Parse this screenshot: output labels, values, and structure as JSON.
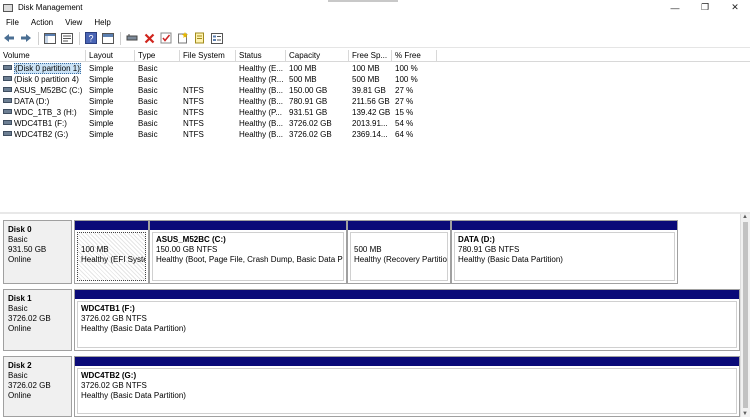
{
  "window": {
    "title": "Disk Management",
    "controls": {
      "minimize": "—",
      "maximize": "❐",
      "close": "✕"
    }
  },
  "menu": [
    "File",
    "Action",
    "View",
    "Help"
  ],
  "toolbar": {
    "buttons": [
      "back-icon",
      "forward-icon",
      "console-tree-icon",
      "properties-icon",
      "help-icon",
      "view-icon",
      "connect-drive-icon",
      "delete-icon",
      "check-icon",
      "new-icon",
      "rescan-icon",
      "settings-icon"
    ]
  },
  "volumes": {
    "columns": [
      "Volume",
      "Layout",
      "Type",
      "File System",
      "Status",
      "Capacity",
      "Free Sp...",
      "% Free"
    ],
    "rows": [
      [
        "(Disk 0 partition 1)",
        "Simple",
        "Basic",
        "",
        "Healthy (E...",
        "100 MB",
        "100 MB",
        "100 %"
      ],
      [
        "(Disk 0 partition 4)",
        "Simple",
        "Basic",
        "",
        "Healthy (R...",
        "500 MB",
        "500 MB",
        "100 %"
      ],
      [
        "ASUS_M52BC (C:)",
        "Simple",
        "Basic",
        "NTFS",
        "Healthy (B...",
        "150.00 GB",
        "39.81 GB",
        "27 %"
      ],
      [
        "DATA (D:)",
        "Simple",
        "Basic",
        "NTFS",
        "Healthy (B...",
        "780.91 GB",
        "211.56 GB",
        "27 %"
      ],
      [
        "WDC_1TB_3 (H:)",
        "Simple",
        "Basic",
        "NTFS",
        "Healthy (P...",
        "931.51 GB",
        "139.42 GB",
        "15 %"
      ],
      [
        "WDC4TB1 (F:)",
        "Simple",
        "Basic",
        "NTFS",
        "Healthy (B...",
        "3726.02 GB",
        "2013.91...",
        "54 %"
      ],
      [
        "WDC4TB2 (G:)",
        "Simple",
        "Basic",
        "NTFS",
        "Healthy (B...",
        "3726.02 GB",
        "2369.14...",
        "64 %"
      ]
    ]
  },
  "disks": [
    {
      "name": "Disk 0",
      "type": "Basic",
      "size": "931.50 GB",
      "status": "Online",
      "partitions": [
        {
          "name": "",
          "size": "100 MB",
          "status": "Healthy (EFI System"
        },
        {
          "name": "ASUS_M52BC  (C:)",
          "size": "150.00 GB NTFS",
          "status": "Healthy (Boot, Page File, Crash Dump, Basic Data Parti"
        },
        {
          "name": "",
          "size": "500 MB",
          "status": "Healthy (Recovery Partition"
        },
        {
          "name": "DATA  (D:)",
          "size": "780.91 GB NTFS",
          "status": "Healthy (Basic Data Partition)"
        }
      ]
    },
    {
      "name": "Disk 1",
      "type": "Basic",
      "size": "3726.02 GB",
      "status": "Online",
      "partitions": [
        {
          "name": "WDC4TB1  (F:)",
          "size": "3726.02 GB NTFS",
          "status": "Healthy (Basic Data Partition)"
        }
      ]
    },
    {
      "name": "Disk 2",
      "type": "Basic",
      "size": "3726.02 GB",
      "status": "Online",
      "partitions": [
        {
          "name": "WDC4TB2  (G:)",
          "size": "3726.02 GB NTFS",
          "status": "Healthy (Basic Data Partition)"
        }
      ]
    }
  ],
  "colors": {
    "partition_bar": "#0a0a78",
    "selection": "#cce4f7",
    "disk_label_bg": "#f0f0f0"
  }
}
